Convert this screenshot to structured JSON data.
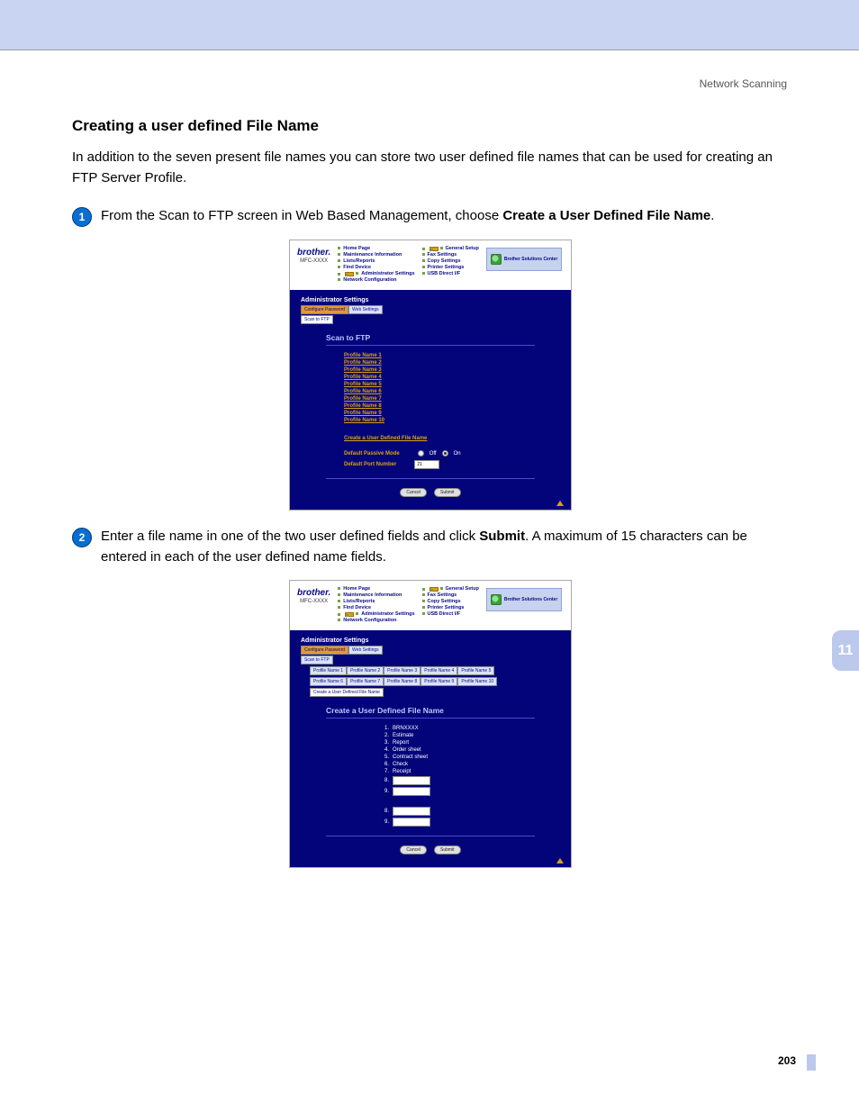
{
  "running_header": "Network Scanning",
  "section_title": "Creating a user defined File Name",
  "intro": "In addition to the seven present file names you can store two user defined file names that can be used for creating an FTP Server Profile.",
  "step1_pre": "From the Scan to FTP screen in Web Based Management, choose ",
  "step1_bold": "Create a User Defined File Name",
  "step1_post": ".",
  "step2_pre": "Enter a file name in one of the two user defined fields and click ",
  "step2_bold": "Submit",
  "step2_post": ". A maximum of 15 characters can be entered in each of the user defined name fields.",
  "brand": "brother.",
  "model": "MFC-XXXX",
  "nav_col1": [
    "Home Page",
    "Maintenance Information",
    "Lists/Reports",
    "Find Device",
    "Administrator Settings",
    "Network Configuration"
  ],
  "nav_col2": [
    "General Setup",
    "Fax Settings",
    "Copy Settings",
    "Printer Settings",
    "USB Direct I/F"
  ],
  "sol_center": "Brother Solutions Center",
  "admin_settings": "Administrator Settings",
  "tab_configure": "Configure Password",
  "tab_web": "Web Settings",
  "tab_scan": "Scan to FTP",
  "shot1": {
    "panel_title": "Scan to FTP",
    "profiles": [
      "Profile Name 1",
      "Profile Name 2",
      "Profile Name 3",
      "Profile Name 4",
      "Profile Name 5",
      "Profile Name 6",
      "Profile Name 7",
      "Profile Name 8",
      "Profile Name 9",
      "Profile Name 10"
    ],
    "create_link": "Create a User Defined File Name",
    "passive_label": "Default Passive Mode",
    "off": "Off",
    "on": "On",
    "port_label": "Default Port Number",
    "port_value": "21"
  },
  "shot2": {
    "profile_tabs": [
      "Profile Name 1",
      "Profile Name 2",
      "Profile Name 3",
      "Profile Name 4",
      "Profile Name 5",
      "Profile Name 6",
      "Profile Name 7",
      "Profile Name 8",
      "Profile Name 9",
      "Profile Name 10"
    ],
    "create_tab": "Create a User Defined File Name",
    "panel_title": "Create a User Defined File Name",
    "preset": [
      "BRNXXXX",
      "Estimate",
      "Report",
      "Order sheet",
      "Contract sheet",
      "Check",
      "Receipt"
    ]
  },
  "cancel": "Cancel",
  "submit": "Submit",
  "chapter_tab": "11",
  "page_number": "203"
}
